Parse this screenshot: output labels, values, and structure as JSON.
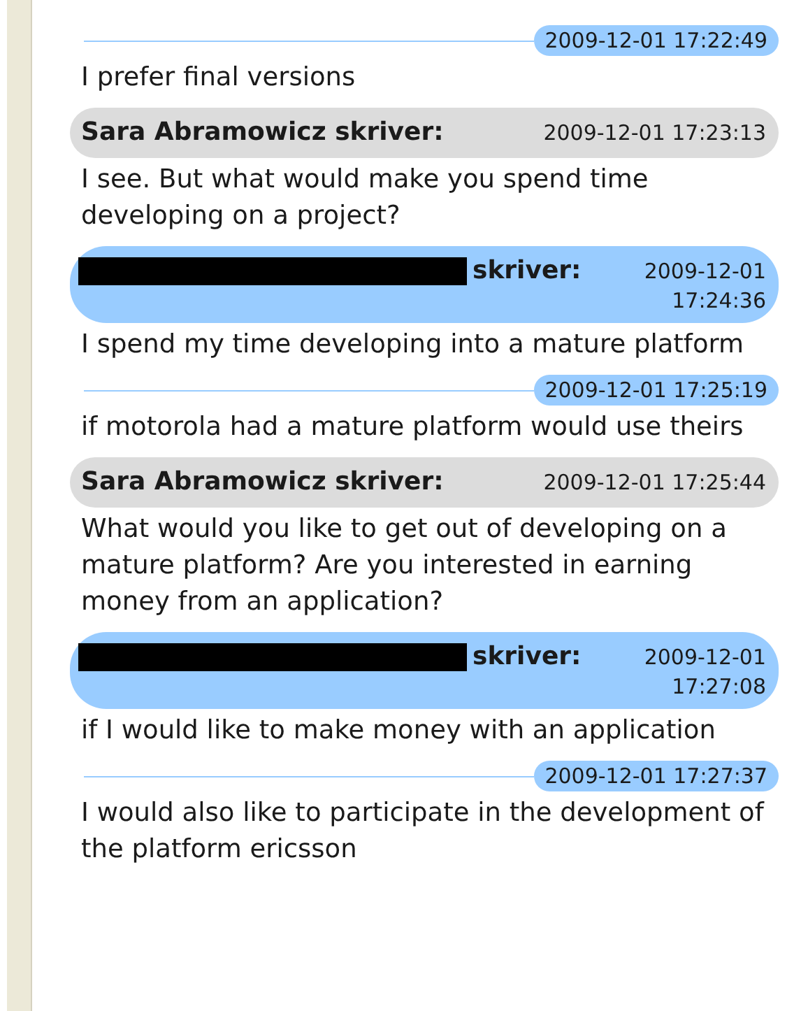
{
  "messages": [
    {
      "kind": "continuation",
      "time": "2009-12-01 17:22:49",
      "text": "I prefer final versions"
    },
    {
      "kind": "header",
      "heading": "Sara Abramowicz skriver:",
      "redacted": false,
      "color": "#dcdcdc",
      "time": "2009-12-01 17:23:13",
      "text": "I see. But what would make you spend time developing on a project?"
    },
    {
      "kind": "header",
      "heading": "skriver:",
      "redacted": true,
      "color": "#99ccff",
      "time": "2009-12-01 17:24:36",
      "text": "I spend my time developing into a mature platform"
    },
    {
      "kind": "continuation",
      "time": "2009-12-01 17:25:19",
      "text": "if motorola had a mature platform would use theirs"
    },
    {
      "kind": "header",
      "heading": "Sara Abramowicz skriver:",
      "redacted": false,
      "color": "#dcdcdc",
      "time": "2009-12-01 17:25:44",
      "text": "What would you like to get out of developing on a mature platform? Are you interested in earning money from an application?"
    },
    {
      "kind": "header",
      "heading": "skriver:",
      "redacted": true,
      "color": "#99ccff",
      "time": "2009-12-01 17:27:08",
      "text": "if I would like to make money with an application"
    },
    {
      "kind": "continuation",
      "time": "2009-12-01 17:27:37",
      "text": "I would also like to participate in the development of the platform ericsson"
    }
  ]
}
